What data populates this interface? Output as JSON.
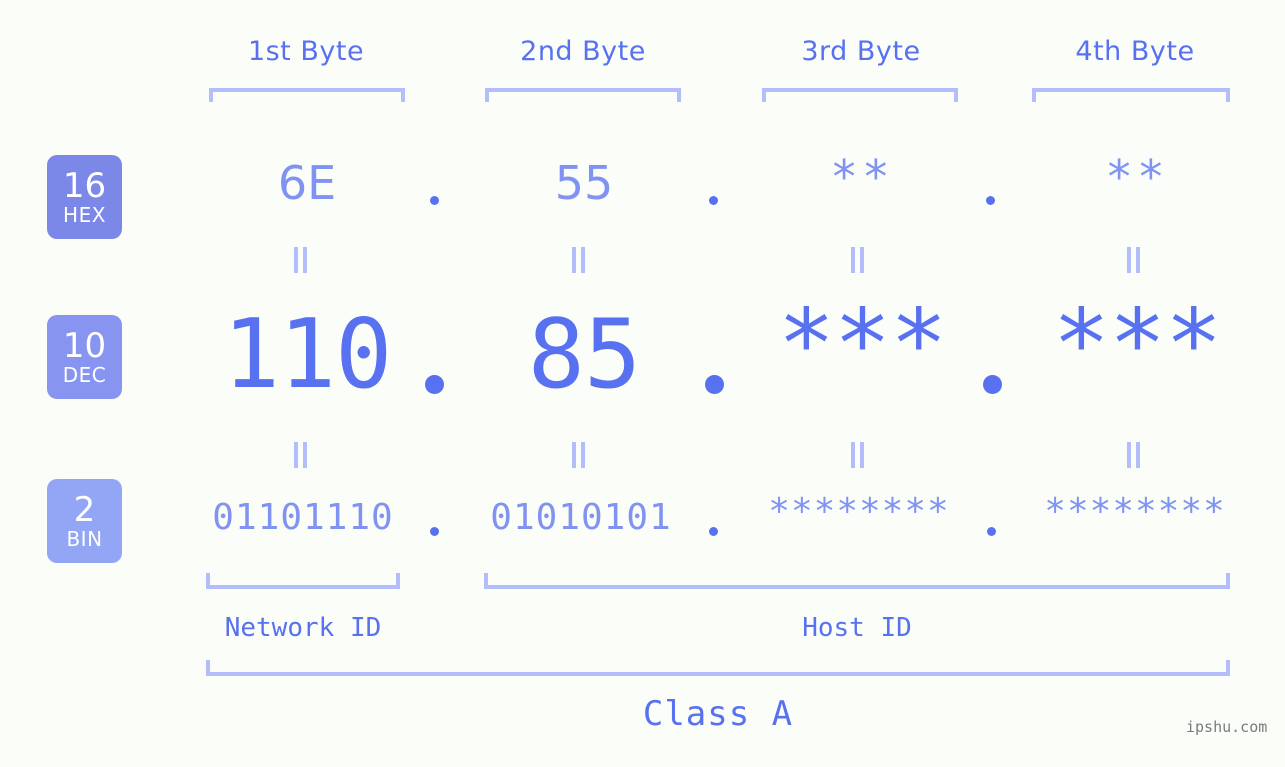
{
  "canvas": {
    "background": "#fbfdf8",
    "accent_strong": "#5871f0",
    "accent_mid": "#8193f2",
    "accent_light": "#b3bdfb"
  },
  "byte_headers": [
    {
      "label": "1st Byte"
    },
    {
      "label": "2nd Byte"
    },
    {
      "label": "3rd Byte"
    },
    {
      "label": "4th Byte"
    }
  ],
  "bases": [
    {
      "number": "16",
      "name": "HEX",
      "color": "#7c88e8"
    },
    {
      "number": "10",
      "name": "DEC",
      "color": "#8795f0"
    },
    {
      "number": "2",
      "name": "BIN",
      "color": "#92a6f5"
    }
  ],
  "rows": {
    "hex": {
      "base_number": "16",
      "base_name": "HEX",
      "values": [
        "6E",
        "55",
        "**",
        "**"
      ],
      "separator": "."
    },
    "dec": {
      "base_number": "10",
      "base_name": "DEC",
      "values": [
        "110",
        "85",
        "***",
        "***"
      ],
      "separator": "."
    },
    "bin": {
      "base_number": "2",
      "base_name": "BIN",
      "values": [
        "01101110",
        "01010101",
        "********",
        "********"
      ],
      "separator": "."
    }
  },
  "equals_symbol": "=",
  "sections": {
    "network_id": "Network ID",
    "host_id": "Host ID",
    "class": "Class A"
  },
  "watermark": "ipshu.com"
}
